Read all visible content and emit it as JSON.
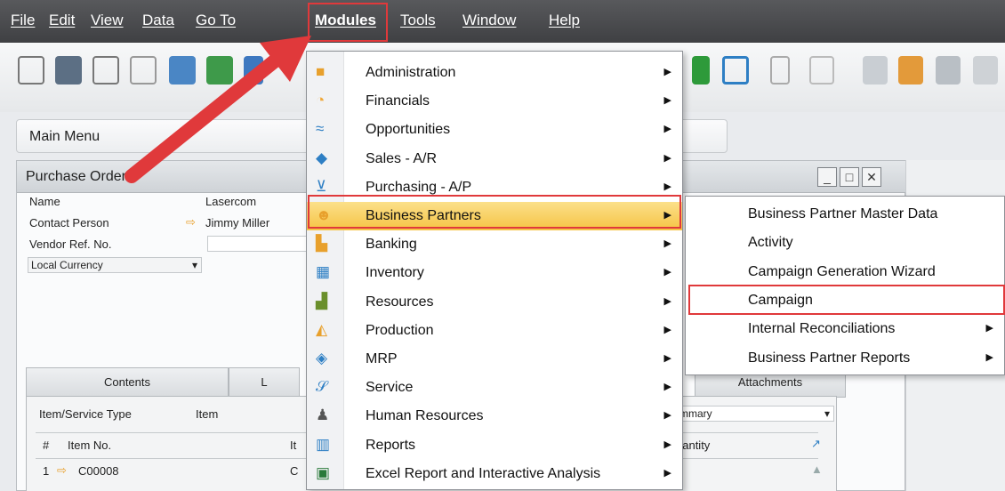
{
  "menubar": {
    "items": [
      {
        "label": "File"
      },
      {
        "label": "Edit"
      },
      {
        "label": "View"
      },
      {
        "label": "Data"
      },
      {
        "label": "Go To"
      },
      {
        "label": "Modules"
      },
      {
        "label": "Tools"
      },
      {
        "label": "Window"
      },
      {
        "label": "Help"
      }
    ]
  },
  "main_menu": {
    "label": "Main Menu"
  },
  "window": {
    "title": "Purchase Order",
    "fields": {
      "name_label": "Name",
      "name_value": "Lasercom",
      "contact_label": "Contact Person",
      "contact_value": "Jimmy Miller",
      "vendor_ref_label": "Vendor Ref. No.",
      "currency_label": "Local Currency"
    },
    "tabs": {
      "contents": "Contents",
      "logistics": "L",
      "attachments": "Attachments"
    },
    "grid": {
      "type_label": "Item/Service Type",
      "type_value": "Item",
      "summary_value": "mmary",
      "col_num": "#",
      "col_item_no": "Item No.",
      "col_it": "It",
      "col_quantity": "uantity",
      "row1_num": "1",
      "row1_item": "C00008",
      "row1_c": "C"
    },
    "buttons": {
      "minimize": "_",
      "maximize": "□",
      "close": "✕"
    }
  },
  "modules_menu": {
    "items": [
      {
        "label": "Administration",
        "icon": "admin-icon",
        "color": "#e8a02c"
      },
      {
        "label": "Financials",
        "icon": "financials-pie-icon",
        "color": "#f0a93b"
      },
      {
        "label": "Opportunities",
        "icon": "opportunities-icon",
        "color": "#2e7fc4"
      },
      {
        "label": "Sales - A/R",
        "icon": "sales-icon",
        "color": "#2e7fc4"
      },
      {
        "label": "Purchasing - A/P",
        "icon": "cart-icon",
        "color": "#2e7fc4"
      },
      {
        "label": "Business Partners",
        "icon": "business-partners-icon",
        "color": "#e8a02c"
      },
      {
        "label": "Banking",
        "icon": "banking-icon",
        "color": "#e8a02c"
      },
      {
        "label": "Inventory",
        "icon": "inventory-icon",
        "color": "#2e7fc4"
      },
      {
        "label": "Resources",
        "icon": "resources-icon",
        "color": "#6a8f2b"
      },
      {
        "label": "Production",
        "icon": "production-icon",
        "color": "#e8a02c"
      },
      {
        "label": "MRP",
        "icon": "mrp-icon",
        "color": "#2e7fc4"
      },
      {
        "label": "Service",
        "icon": "service-icon",
        "color": "#2e7fc4"
      },
      {
        "label": "Human Resources",
        "icon": "human-resources-icon",
        "color": "#555555"
      },
      {
        "label": "Reports",
        "icon": "reports-icon",
        "color": "#2e7fc4"
      },
      {
        "label": "Excel Report and Interactive Analysis",
        "icon": "excel-icon",
        "color": "#2a7a3b"
      }
    ]
  },
  "bp_submenu": {
    "items": [
      {
        "label": "Business Partner Master Data"
      },
      {
        "label": "Activity"
      },
      {
        "label": "Campaign Generation Wizard"
      },
      {
        "label": "Campaign"
      },
      {
        "label": "Internal Reconciliations"
      },
      {
        "label": "Business Partner Reports"
      }
    ]
  },
  "colors": {
    "highlight": "#f6c343",
    "callout_red": "#e0393b",
    "menubar": "#4a4b4e"
  }
}
